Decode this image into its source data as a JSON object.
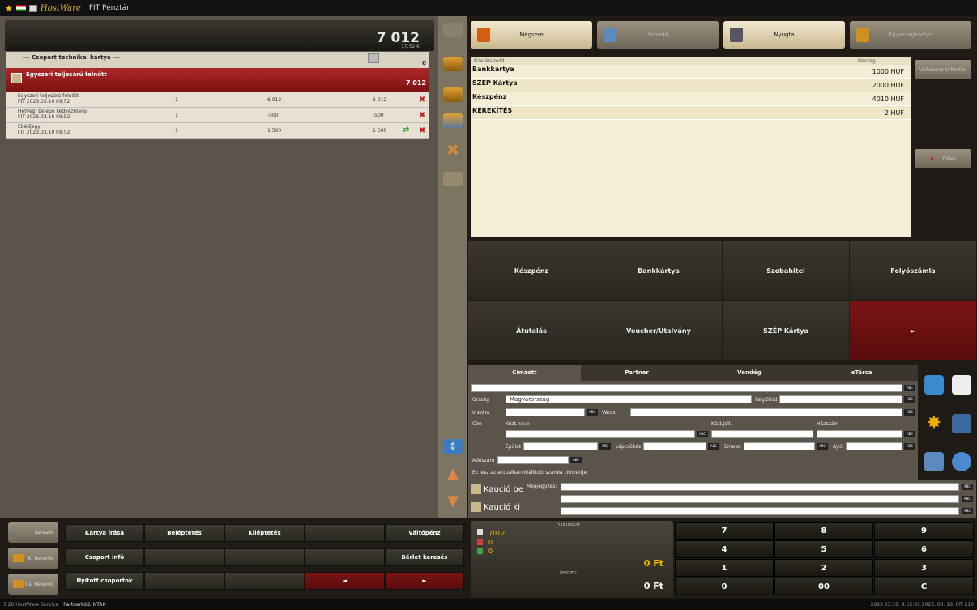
{
  "app": {
    "title": "FIT Pénztár",
    "logo_text": "HostWare"
  },
  "left": {
    "header_amount": "7 012",
    "header_sub": "17,52 €",
    "group_title": "--- Csoport technikai kártya ---",
    "group_count": "0",
    "selected_row": {
      "label": "Egyszeri teljesárú felnőtt",
      "amount": "7 012"
    },
    "items": [
      {
        "name": "Egyszeri teljesárú felnőtt",
        "date": "FIT 2023.03.10 09:52",
        "qty": "1",
        "price": "6 012",
        "total": "6 012"
      },
      {
        "name": "Hétvégi belépő kedvezmény",
        "date": "FIT 2023.03.10 09:52",
        "qty": "1",
        "price": "-500",
        "total": "-500"
      },
      {
        "name": "Ebédjegy",
        "date": "FIT 2023.03.10 09:52",
        "qty": "1",
        "price": "1 500",
        "total": "1 500"
      }
    ]
  },
  "top_buttons": [
    {
      "label": "Mégsem",
      "disabled": false
    },
    {
      "label": "Számla",
      "disabled": true
    },
    {
      "label": "Nyugta",
      "disabled": false
    },
    {
      "label": "Egyenlegkártya",
      "disabled": true
    }
  ],
  "payments": {
    "col_method": "Fizetési mód",
    "col_amount": "Összeg",
    "rows": [
      {
        "method": "Bankkártya",
        "amount": "1000 HUF"
      },
      {
        "method": "SZÉP Kártya",
        "amount": "2000 HUF"
      },
      {
        "method": "Készpénz",
        "amount": "4010 HUF"
      },
      {
        "method": "KEREKÍTÉS",
        "amount": "2 HUF"
      }
    ],
    "side_buttons": [
      "Váltópénz ki fizetés",
      "Törlés"
    ]
  },
  "pay_methods": [
    "Készpénz",
    "Bankkártya",
    "Szobahitel",
    "Folyószámla",
    "Átutalás",
    "Voucher/Utalvány",
    "SZÉP Kártya",
    "►"
  ],
  "tabs": [
    "Címzett",
    "Partner",
    "Vendég",
    "eTárca"
  ],
  "form": {
    "orszag_label": "Ország",
    "orszag_value": "Magyarország",
    "regiokod_label": "Régiókód",
    "irszam_label": "Ir.szám",
    "varos_label": "Város",
    "cim_label": "Cím",
    "kozt_neve_label": "Közt.neve",
    "kozt_jell_label": "Közt.jell.",
    "hazszam_label": "Házszám",
    "epulet_label": "Épület",
    "lepcsohaz_label": "Lépcsőház",
    "emelet_label": "Emelet",
    "ajto_label": "Ajtó",
    "adoszam_label": "Adószám",
    "note": "Ez lesz az aktuálisan kiállított számla címzettje",
    "abc": "ABC"
  },
  "notes": {
    "kaucio_be": "Kaució be",
    "kaucio_ki": "Kaució ki",
    "megjegyzes": "Megjegyzés:"
  },
  "bottom": {
    "side": [
      "Keresés",
      "K. bekérés",
      "Cs. bekérés"
    ],
    "row1": [
      "Kártya írása",
      "Beléptetés",
      "Kiléptetés",
      "",
      "Váltópénz"
    ],
    "row2": [
      "Csoport infó",
      "",
      "",
      "",
      "Bérlet keresés"
    ],
    "row3": [
      "Nyitott csoportok",
      "",
      "",
      "◄",
      "►"
    ]
  },
  "sum": {
    "fizetendo": "FIZETENDŐ",
    "v1": "7012",
    "v2": "0",
    "v3": "0",
    "total1": "0 Ft",
    "osszeg": "ÖSSZEG",
    "total2": "0 Ft"
  },
  "keypad": [
    "7",
    "8",
    "9",
    "4",
    "5",
    "6",
    "1",
    "2",
    "3",
    "0",
    "00",
    "C"
  ],
  "status": {
    "left": "7.26  HostWare Service",
    "partner": "Partnerkód: NTAK",
    "right": "2023.03.10. 9:55:01  2023. 03. 10.  FIT 210"
  }
}
